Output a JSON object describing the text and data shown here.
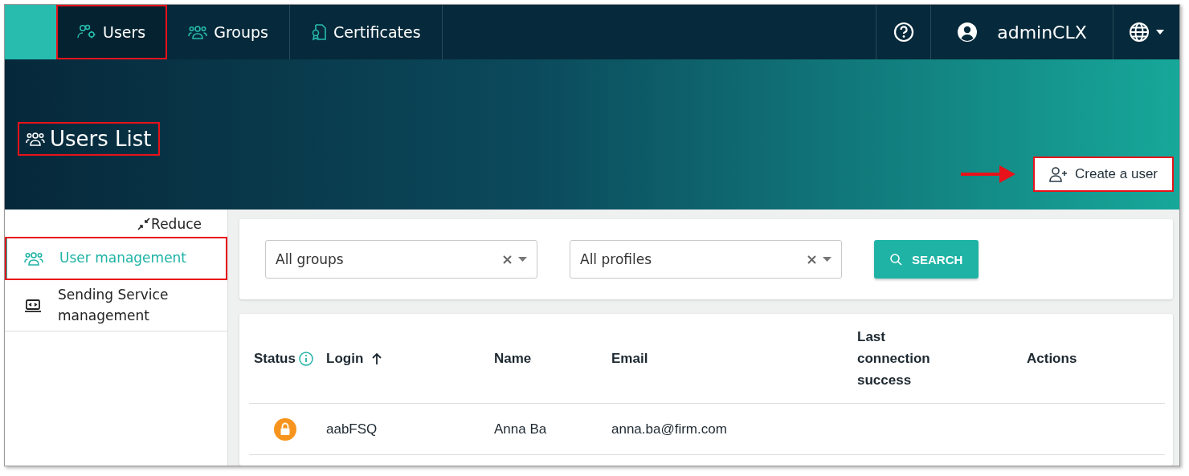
{
  "nav": {
    "tabs": [
      {
        "label": "Users",
        "selected": true,
        "highlighted": true
      },
      {
        "label": "Groups",
        "selected": false,
        "highlighted": false
      },
      {
        "label": "Certificates",
        "selected": false,
        "highlighted": false
      }
    ],
    "user": "adminCLX"
  },
  "header": {
    "title": "Users List",
    "highlighted": true,
    "create_button": {
      "label": "Create a user",
      "highlighted": true,
      "arrow": true
    }
  },
  "sidebar": {
    "reduce": "Reduce",
    "items": [
      {
        "label": "User management",
        "selected": true,
        "highlighted": true
      },
      {
        "label": "Sending Service management",
        "selected": false,
        "highlighted": false
      }
    ]
  },
  "filters": {
    "fields": [
      {
        "value": "All groups"
      },
      {
        "value": "All profiles"
      }
    ],
    "search_button": "SEARCH"
  },
  "table": {
    "columns": [
      {
        "label": "Status",
        "info": true,
        "sorted": false
      },
      {
        "label": "Login",
        "info": false,
        "sorted": true
      },
      {
        "label": "Name",
        "info": false,
        "sorted": false
      },
      {
        "label": "Email",
        "info": false,
        "sorted": false
      },
      {
        "label": "Last connection success",
        "info": false,
        "sorted": false
      },
      {
        "label": "Actions",
        "info": false,
        "sorted": false
      }
    ],
    "rows": [
      {
        "locked": true,
        "login": "aabFSQ",
        "name": "Anna Ba",
        "email": "anna.ba@firm.com"
      }
    ]
  }
}
